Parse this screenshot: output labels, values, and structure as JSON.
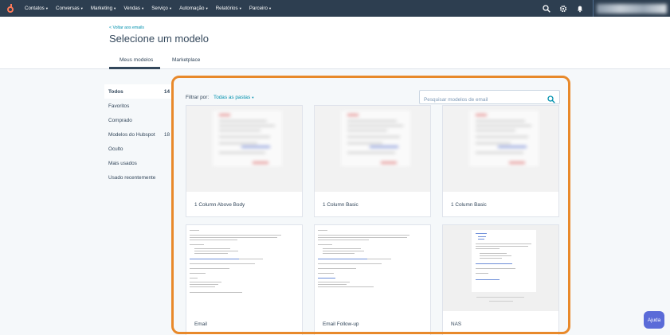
{
  "topnav": {
    "logo_icon": "hubspot-sprocket-icon",
    "items": [
      {
        "label": "Contatos"
      },
      {
        "label": "Conversas"
      },
      {
        "label": "Marketing"
      },
      {
        "label": "Vendas"
      },
      {
        "label": "Serviço"
      },
      {
        "label": "Automação"
      },
      {
        "label": "Relatórios"
      },
      {
        "label": "Parceiro"
      }
    ],
    "icons": [
      "search-icon",
      "gear-icon",
      "bell-icon"
    ]
  },
  "header": {
    "back_link": "< Voltar aos emails",
    "title": "Selecione um modelo",
    "tabs": [
      {
        "label": "Meus modelos",
        "active": true
      },
      {
        "label": "Marketplace",
        "active": false
      }
    ]
  },
  "sidebar": {
    "items": [
      {
        "label": "Todos",
        "count": "14",
        "active": true
      },
      {
        "label": "Favoritos",
        "count": ""
      },
      {
        "label": "Comprado",
        "count": ""
      },
      {
        "label": "Modelos do Hubspot",
        "count": "18"
      },
      {
        "label": "Oculto",
        "count": ""
      },
      {
        "label": "Mais usados",
        "count": ""
      },
      {
        "label": "Usado recentemente",
        "count": ""
      }
    ]
  },
  "filter": {
    "label": "Filtrar por:",
    "value": "Todas as pastas"
  },
  "search": {
    "placeholder": "Pesquisar modelos de email",
    "value": ""
  },
  "templates": [
    {
      "name": "1 Column Above Body"
    },
    {
      "name": "1 Column Basic"
    },
    {
      "name": "1 Column Basic"
    },
    {
      "name": "Email"
    },
    {
      "name": "Email Follow-up"
    },
    {
      "name": "NAS"
    }
  ],
  "help": {
    "label": "Ajuda"
  },
  "colors": {
    "nav_bg": "#2d3e50",
    "accent_link": "#0091ae",
    "highlight": "#e8892a",
    "help_button": "#5a6bd8",
    "logo": "#ff7a59"
  }
}
